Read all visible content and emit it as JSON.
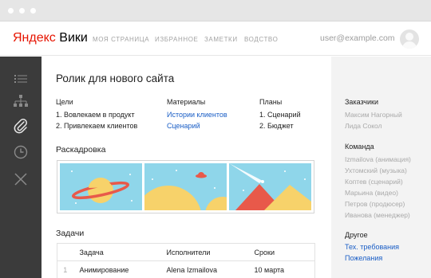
{
  "header": {
    "logo_brand": "Яндекс",
    "logo_product": "Вики",
    "nav": [
      "МОЯ СТРАНИЦА",
      "ИЗБРАННОЕ",
      "ЗАМЕТКИ",
      "ВОДСТВО"
    ],
    "user_email": "user@example.com"
  },
  "sidebar": {
    "icons": [
      "list-icon",
      "sitemap-icon",
      "paperclip-icon",
      "clock-icon",
      "close-icon"
    ],
    "active_index": 2
  },
  "page": {
    "title": "Ролик для нового сайта",
    "columns": {
      "goals": {
        "label": "Цели",
        "items": [
          "1. Вовлекаем в продукт",
          "2. Привлекаем клиентов"
        ]
      },
      "materials": {
        "label": "Материалы",
        "items": [
          "Истории клиентов",
          "Сценарий"
        ]
      },
      "plans": {
        "label": "Планы",
        "items": [
          "1. Сценарий",
          "2. Бюджет"
        ]
      }
    },
    "storyboard_title": "Раскадровка",
    "tasks_title": "Задачи",
    "tasks_table": {
      "headers": [
        "",
        "Задача",
        "Исполнители",
        "Сроки"
      ],
      "rows": [
        [
          "1",
          "Анимирование",
          "Alena Izmailova",
          "10 марта"
        ]
      ]
    }
  },
  "right_panel": {
    "customers": {
      "label": "Заказчики",
      "items": [
        "Максим Нагорный",
        "Лида Сокол"
      ]
    },
    "team": {
      "label": "Команда",
      "items": [
        "Izmailova (анимация)",
        "Ухтомский (музыка)",
        "Коптев (сценарий)",
        "Марьина (видео)",
        "Петров (продюсер)",
        "Иванова (менеджер)"
      ]
    },
    "other": {
      "label": "Другое",
      "links": [
        "Тех. требования",
        "Пожелания"
      ]
    }
  },
  "colors": {
    "brand_red": "#e61400",
    "link_blue": "#1a5ec6",
    "sidebar_bg": "#3b3b3b",
    "sky": "#8fd6ea",
    "sand": "#f7d26a",
    "planet_ring": "#e8594a"
  }
}
